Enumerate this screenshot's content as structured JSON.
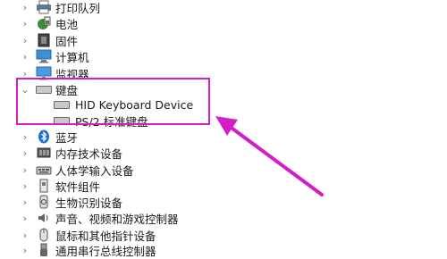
{
  "tree": {
    "items": [
      {
        "label": "打印队列",
        "icon": "printer-icon"
      },
      {
        "label": "电池",
        "icon": "battery-icon"
      },
      {
        "label": "固件",
        "icon": "firmware-chip-icon"
      },
      {
        "label": "计算机",
        "icon": "computer-icon"
      },
      {
        "label": "监视器",
        "icon": "monitor-icon"
      },
      {
        "label": "键盘",
        "icon": "keyboard-icon",
        "expanded": true,
        "children": [
          {
            "label": "HID Keyboard Device",
            "icon": "keyboard-icon"
          },
          {
            "label": "PS/2 标准键盘",
            "icon": "keyboard-icon"
          }
        ]
      },
      {
        "label": "蓝牙",
        "icon": "bluetooth-icon"
      },
      {
        "label": "内存技术设备",
        "icon": "memory-device-icon"
      },
      {
        "label": "人体学输入设备",
        "icon": "hid-icon"
      },
      {
        "label": "软件组件",
        "icon": "software-component-icon"
      },
      {
        "label": "生物识别设备",
        "icon": "fingerprint-icon"
      },
      {
        "label": "声音、视频和游戏控制器",
        "icon": "speaker-icon"
      },
      {
        "label": "鼠标和其他指针设备",
        "icon": "mouse-icon"
      },
      {
        "label": "通用串行总线控制器",
        "icon": "usb-icon"
      }
    ]
  },
  "annotation": {
    "color": "#d21ec4"
  }
}
